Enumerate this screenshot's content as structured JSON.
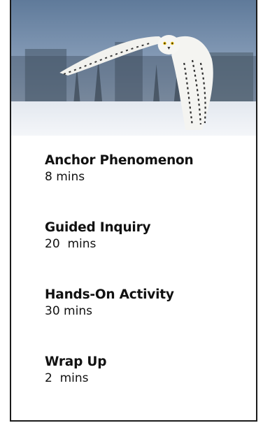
{
  "hero": {
    "image_subject": "snowy-owl-in-flight"
  },
  "agenda": {
    "items": [
      {
        "title": "Anchor Phenomenon",
        "duration": "8 mins"
      },
      {
        "title": "Guided Inquiry",
        "duration": "20  mins"
      },
      {
        "title": "Hands-On Activity",
        "duration": "30 mins"
      },
      {
        "title": "Wrap Up",
        "duration": "2  mins"
      }
    ]
  }
}
